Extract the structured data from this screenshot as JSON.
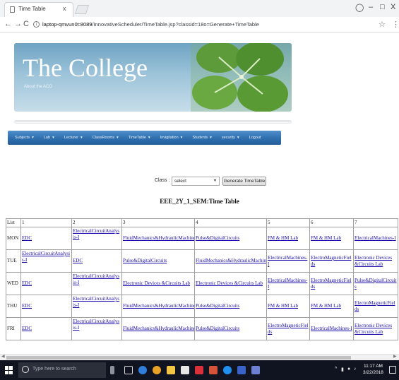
{
  "browser": {
    "tab_title": "Time Table",
    "tab_close": "x",
    "url_host": "laptop-qmvun0t:8089",
    "url_path": "/InnovativeScheduler/TimeTable.jsp?classid=18o=Generate+TimeTable",
    "window_controls": {
      "minimize": "–",
      "maximize": "□",
      "close": "X"
    },
    "nav_icons": [
      "back-icon",
      "forward-icon",
      "reload-icon"
    ]
  },
  "banner": {
    "title": "The College",
    "subtitle": "About the ACO"
  },
  "menu": [
    {
      "label": "Subjects",
      "has_dropdown": true
    },
    {
      "label": "Lab",
      "has_dropdown": true
    },
    {
      "label": "Lecturer",
      "has_dropdown": true
    },
    {
      "label": "ClassRooms",
      "has_dropdown": true
    },
    {
      "label": "TimeTable",
      "has_dropdown": true
    },
    {
      "label": "Invigilation",
      "has_dropdown": true
    },
    {
      "label": "Students",
      "has_dropdown": true
    },
    {
      "label": "security",
      "has_dropdown": true
    },
    {
      "label": "Logout",
      "has_dropdown": false
    }
  ],
  "form": {
    "class_label": "Class :",
    "select_value": "select",
    "generate_button": "Generate TimeTable"
  },
  "timetable": {
    "title": "EEE_2Y_1_SEM:Time Table",
    "header": [
      "List",
      "1",
      "2",
      "3",
      "4",
      "5",
      "6",
      "7"
    ],
    "rows": [
      {
        "day": "MON",
        "cells": [
          "EDC",
          "ElectricalCircuitAnalysis-I",
          "FluidMechanics&HydraulicMachines",
          "Pulse&DigitalCircuits",
          "FM & HM Lab",
          "FM & HM Lab",
          "ElectricalMachines-I"
        ]
      },
      {
        "day": "TUE",
        "cells": [
          "ElectricalCircuitAnalysis-I",
          "EDC",
          "Pulse&DigitalCircuits",
          "FluidMechanics&HydraulicMachines",
          "ElectricalMachines-I",
          "ElectroMagneticFields",
          "Electronic Devices &Circuits Lab"
        ]
      },
      {
        "day": "WED",
        "cells": [
          "EDC",
          "ElectricalCircuitAnalysis-I",
          "Electronic Devices &Circuits Lab",
          "Electronic Devices &Circuits Lab",
          "ElectricalMachines-I",
          "ElectroMagneticFields",
          "Pulse&DigitalCircuits"
        ]
      },
      {
        "day": "THU",
        "cells": [
          "EDC",
          "ElectricalCircuitAnalysis-I",
          "FluidMechanics&HydraulicMachines",
          "Pulse&DigitalCircuits",
          "FM & HM Lab",
          "FM & HM Lab",
          "ElectroMagneticFields"
        ]
      },
      {
        "day": "FRI",
        "cells": [
          "EDC",
          "ElectricalCircuitAnalysis-I",
          "FluidMechanics&HydraulicMachines",
          "Pulse&DigitalCircuits",
          "ElectroMagneticFields",
          "ElectricalMachines-I",
          "Electronic Devices &Circuits Lab"
        ]
      }
    ]
  },
  "taskbar": {
    "search_placeholder": "Type here to search",
    "clock_time": "11:17 AM",
    "clock_date": "3/22/2018",
    "pinned_icons": [
      "mic-icon",
      "task-view-icon",
      "edge-icon",
      "chrome-icon",
      "explorer-icon",
      "store-icon",
      "mail-icon",
      "powerpoint-icon",
      "skype-icon",
      "snipping-icon",
      "app-icon"
    ],
    "tray_icons": [
      "chevron-up-icon",
      "battery-icon",
      "wifi-icon",
      "volume-icon"
    ]
  },
  "colors": {
    "link": "#1a0dab",
    "menu_bar": "#2f6fae",
    "taskbar": "#101420",
    "banner_sky": "#8ab8d2"
  }
}
